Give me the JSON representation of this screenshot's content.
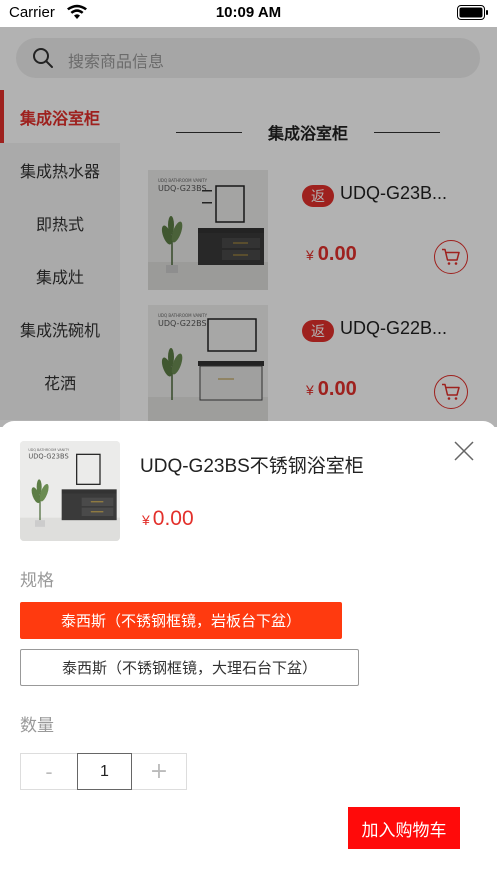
{
  "status_bar": {
    "carrier": "Carrier",
    "time": "10:09 AM"
  },
  "search": {
    "placeholder": "搜索商品信息"
  },
  "sidebar": {
    "items": [
      {
        "label": "集成浴室柜",
        "active": true
      },
      {
        "label": "集成热水器"
      },
      {
        "label": "即热式"
      },
      {
        "label": "集成灶"
      },
      {
        "label": "集成洗碗机"
      },
      {
        "label": "花洒"
      }
    ]
  },
  "section": {
    "title": "集成浴室柜"
  },
  "products": [
    {
      "tag": "返",
      "name": "UDQ-G23B...",
      "currency": "¥",
      "price": "0.00",
      "image_label": "UDQ-G23BS"
    },
    {
      "tag": "返",
      "name": "UDQ-G22B...",
      "currency": "¥",
      "price": "0.00",
      "image_label": "UDQ-G22BS"
    }
  ],
  "sheet": {
    "product_name": "UDQ-G23BS不锈钢浴室柜",
    "currency": "¥",
    "price": "0.00",
    "image_label": "UDQ-G23BS",
    "spec_label": "规格",
    "spec_options": [
      {
        "label": "泰西斯（不锈钢框镜，岩板台下盆）",
        "selected": true
      },
      {
        "label": "泰西斯（不锈钢框镜，大理石台下盆）",
        "selected": false
      }
    ],
    "quantity_label": "数量",
    "quantity": "1",
    "minus_label": "-",
    "plus_label": "+",
    "add_to_cart_label": "加入购物车"
  },
  "colors": {
    "accent": "#e3302b",
    "selected_spec": "#ff3a0f",
    "add_button": "#ff0a0a"
  },
  "icons": [
    "wifi-icon",
    "battery-icon",
    "search-icon",
    "cart-icon",
    "close-icon"
  ]
}
